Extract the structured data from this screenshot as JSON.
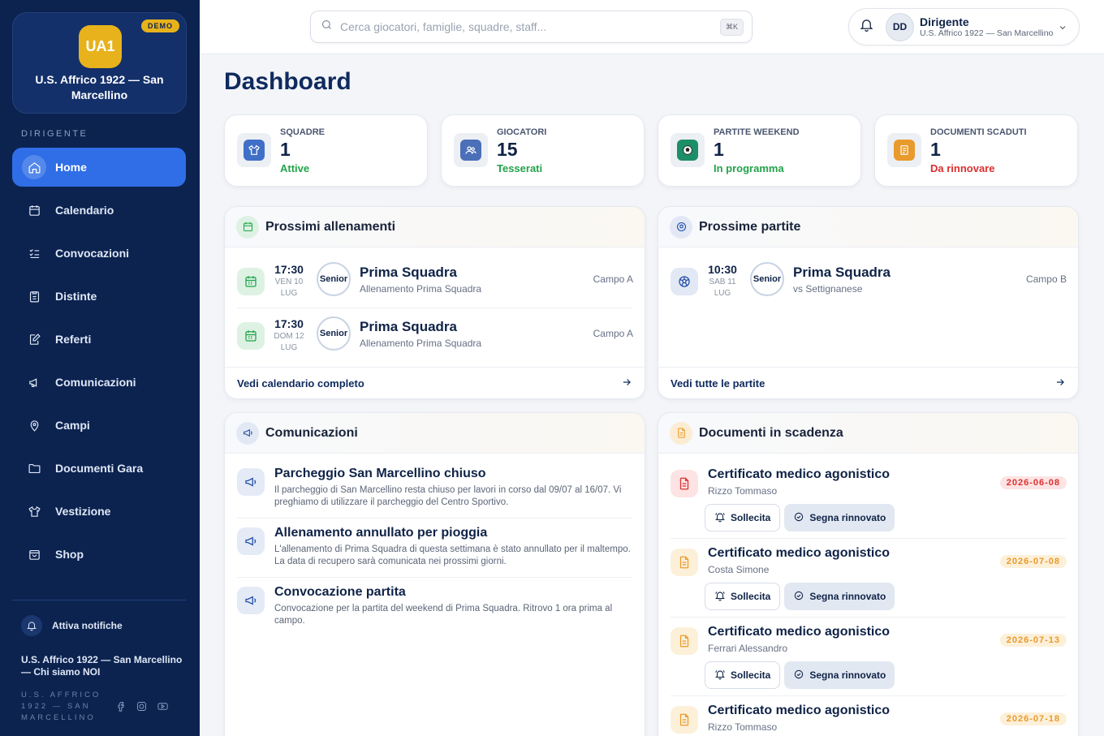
{
  "sidebar": {
    "club_initials": "UA1",
    "demo_badge": "DEMO",
    "club_name": "U.S. Affrico 1922 — San Marcellino",
    "role_label": "DIRIGENTE",
    "items": [
      {
        "label": "Home",
        "icon": "home-icon"
      },
      {
        "label": "Calendario",
        "icon": "calendar-icon"
      },
      {
        "label": "Convocazioni",
        "icon": "checklist-icon"
      },
      {
        "label": "Distinte",
        "icon": "clipboard-icon"
      },
      {
        "label": "Referti",
        "icon": "edit-document-icon"
      },
      {
        "label": "Comunicazioni",
        "icon": "megaphone-icon"
      },
      {
        "label": "Campi",
        "icon": "map-pin-icon"
      },
      {
        "label": "Documenti Gara",
        "icon": "folder-icon"
      },
      {
        "label": "Vestizione",
        "icon": "shirt-icon"
      },
      {
        "label": "Shop",
        "icon": "shopping-bag-icon"
      }
    ],
    "notifications_label": "Attiva notifiche",
    "footer_name": "U.S. Affrico 1922 — San Marcellino — Chi siamo NOI",
    "footer_small": "U.S. AFFRICO 1922 — SAN MARCELLINO"
  },
  "topbar": {
    "search_placeholder": "Cerca giocatori, famiglie, squadre, staff...",
    "shortcut": "⌘K",
    "user_initials": "DD",
    "user_role": "Dirigente",
    "user_club": "U.S. Affrico 1922 — San Marcellino"
  },
  "page_title": "Dashboard",
  "stats": [
    {
      "label": "SQUADRE",
      "value": "1",
      "sub": "Attive",
      "color": "#22a34a"
    },
    {
      "label": "GIOCATORI",
      "value": "15",
      "sub": "Tesserati",
      "color": "#22a34a"
    },
    {
      "label": "PARTITE WEEKEND",
      "value": "1",
      "sub": "In programma",
      "color": "#22a34a"
    },
    {
      "label": "DOCUMENTI SCADUTI",
      "value": "1",
      "sub": "Da rinnovare",
      "color": "#dc2f2f"
    }
  ],
  "trainings": {
    "title": "Prossimi allenamenti",
    "items": [
      {
        "time": "17:30",
        "day": "VEN 10",
        "month": "LUG",
        "category": "Senior",
        "title": "Prima Squadra",
        "subtitle": "Allenamento Prima Squadra",
        "place": "Campo A"
      },
      {
        "time": "17:30",
        "day": "DOM 12",
        "month": "LUG",
        "category": "Senior",
        "title": "Prima Squadra",
        "subtitle": "Allenamento Prima Squadra",
        "place": "Campo A"
      }
    ],
    "footer": "Vedi calendario completo"
  },
  "matches": {
    "title": "Prossime partite",
    "items": [
      {
        "time": "10:30",
        "day": "SAB 11",
        "month": "LUG",
        "category": "Senior",
        "title": "Prima Squadra",
        "subtitle": "vs Settignanese",
        "place": "Campo B"
      }
    ],
    "footer": "Vedi tutte le partite"
  },
  "communications": {
    "title": "Comunicazioni",
    "items": [
      {
        "title": "Parcheggio San Marcellino chiuso",
        "body": "Il parcheggio di San Marcellino resta chiuso per lavori in corso dal 09/07 al 16/07. Vi preghiamo di utilizzare il parcheggio del Centro Sportivo."
      },
      {
        "title": "Allenamento annullato per pioggia",
        "body": "L'allenamento di Prima Squadra di questa settimana è stato annullato per il maltempo. La data di recupero sarà comunicata nei prossimi giorni."
      },
      {
        "title": "Convocazione partita",
        "body": "Convocazione per la partita del weekend di Prima Squadra. Ritrovo 1 ora prima al campo."
      }
    ]
  },
  "documents": {
    "title": "Documenti in scadenza",
    "sollecita_label": "Sollecita",
    "rinnovato_label": "Segna rinnovato",
    "items": [
      {
        "title": "Certificato medico agonistico",
        "name": "Rizzo Tommaso",
        "date": "2026-06-08",
        "status": "expired"
      },
      {
        "title": "Certificato medico agonistico",
        "name": "Costa Simone",
        "date": "2026-07-08",
        "status": "expiring"
      },
      {
        "title": "Certificato medico agonistico",
        "name": "Ferrari Alessandro",
        "date": "2026-07-13",
        "status": "expiring"
      },
      {
        "title": "Certificato medico agonistico",
        "name": "Rizzo Tommaso",
        "date": "2026-07-18",
        "status": "expiring"
      }
    ]
  },
  "colors": {
    "sidebar_bg": "#0c2350",
    "accent": "#2f6ee6",
    "gold": "#e7b21c",
    "success": "#22a34a",
    "danger": "#dc2f2f"
  }
}
